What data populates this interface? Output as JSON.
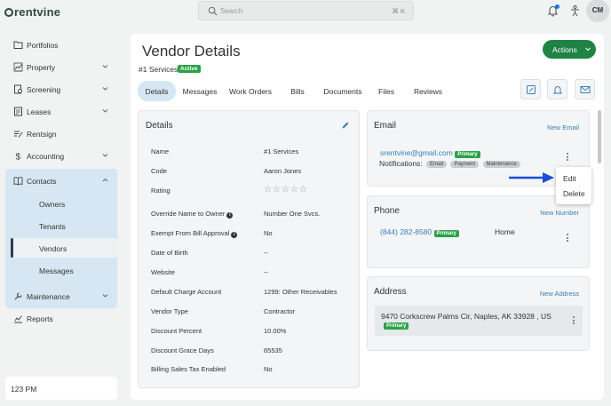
{
  "app": {
    "logo": "rentvine",
    "search_placeholder": "Search",
    "search_shortcut": "⌘ K",
    "avatar_initials": "CM"
  },
  "sidebar": {
    "items": [
      {
        "label": "Portfolios",
        "icon": "folder-icon",
        "chevron": false
      },
      {
        "label": "Property",
        "icon": "property-chart-icon",
        "chevron": true
      },
      {
        "label": "Screening",
        "icon": "screening-icon",
        "chevron": true
      },
      {
        "label": "Leases",
        "icon": "lease-document-icon",
        "chevron": true
      },
      {
        "label": "Rentsign",
        "icon": "sign-icon",
        "chevron": false
      },
      {
        "label": "Accounting",
        "icon": "dollar-icon",
        "chevron": true
      },
      {
        "label": "Contacts",
        "icon": "contacts-book-icon",
        "chevron": true
      },
      {
        "label": "Maintenance",
        "icon": "wrench-icon",
        "chevron": true
      },
      {
        "label": "Reports",
        "icon": "reports-chart-icon",
        "chevron": false
      }
    ],
    "contacts_sub": [
      "Owners",
      "Tenants",
      "Vendors",
      "Messages"
    ],
    "active_sub": "Vendors",
    "time": "123 PM"
  },
  "page": {
    "title": "Vendor Details",
    "vendor_name": "#1 Services",
    "status": "Active",
    "actions_label": "Actions",
    "tabs": [
      "Details",
      "Messages",
      "Work Orders",
      "Bills",
      "Documents",
      "Files",
      "Reviews"
    ],
    "active_tab": "Details"
  },
  "details": {
    "title": "Details",
    "rows": [
      {
        "label": "Name",
        "value": "#1 Services"
      },
      {
        "label": "Code",
        "value": "Aaron Jones"
      },
      {
        "label": "Rating",
        "value": ""
      },
      {
        "label": "Override Name to Owner",
        "value": "Number One Svcs.",
        "info": true
      },
      {
        "label": "Exempt From Bill Approval",
        "value": "No",
        "info": true
      },
      {
        "label": "Date of Birth",
        "value": "--"
      },
      {
        "label": "Website",
        "value": "--"
      },
      {
        "label": "Default Charge Account",
        "value": "1299: Other Receivables"
      },
      {
        "label": "Vendor Type",
        "value": "Contractor"
      },
      {
        "label": "Discount Percent",
        "value": "10.00%"
      },
      {
        "label": "Discount Grace Days",
        "value": "65535"
      },
      {
        "label": "Billing Sales Tax Enabled",
        "value": "No"
      }
    ],
    "rating_stars": "☆☆☆☆☆"
  },
  "email": {
    "title": "Email",
    "new_label": "New Email",
    "address": "srentvine@gmail.com",
    "primary": "Primary",
    "notifications_label": "Notifications:",
    "notification_tags": [
      "Email",
      "Payment",
      "Maintenance"
    ]
  },
  "phone": {
    "title": "Phone",
    "new_label": "New Number",
    "number": "(844) 282-8580",
    "primary": "Primary",
    "type": "Home"
  },
  "address": {
    "title": "Address",
    "new_label": "New Address",
    "line": "9470 Corkscrew Palms Cir, Naples, AK 33928 , US",
    "primary": "Primary"
  },
  "context_menu": {
    "items": [
      "Edit",
      "Delete"
    ]
  },
  "colors": {
    "brand_green": "#1e8345",
    "badge_green": "#2aa247",
    "link_blue": "#3a7fb7",
    "nav_highlight": "#d6e7f3",
    "annotation_arrow": "#1a4fd6"
  }
}
